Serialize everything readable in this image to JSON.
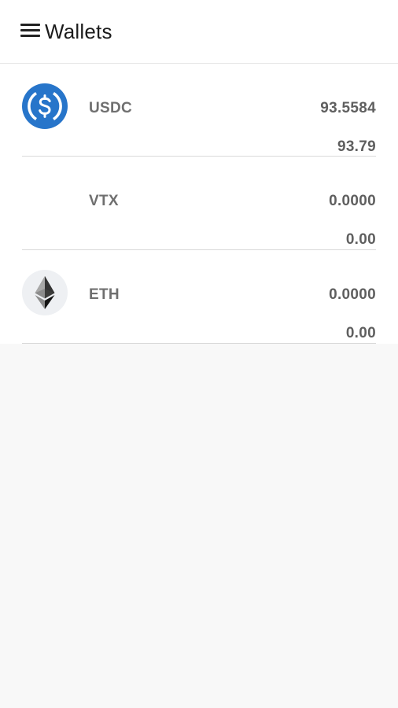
{
  "header": {
    "title": "Wallets",
    "menu_icon": "hamburger-menu-icon"
  },
  "wallets": [
    {
      "symbol": "USDC",
      "icon": "usdc-coin-icon",
      "icon_color": "#2775ca",
      "amount": "93.5584",
      "fiat": "93.79"
    },
    {
      "symbol": "VTX",
      "icon": "",
      "amount": "0.0000",
      "fiat": "0.00"
    },
    {
      "symbol": "ETH",
      "icon": "ethereum-icon",
      "icon_color": "#343434",
      "amount": "0.0000",
      "fiat": "0.00"
    }
  ],
  "colors": {
    "topbar_bg": "#ffffff",
    "page_bg": "#f8f8f8",
    "label_gray": "#6f6f6f",
    "divider": "#d9d9d9"
  }
}
